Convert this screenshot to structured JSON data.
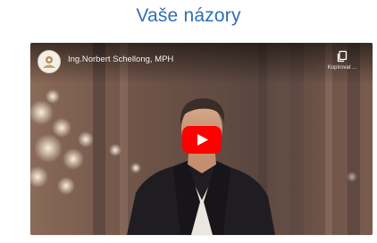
{
  "page": {
    "heading": "Vaše názory"
  },
  "video": {
    "title": "Ing.Norbert Schellong, MPH",
    "copy_link_label": "Kopírovat ...",
    "play_icon": "play-icon",
    "copy_icon": "copy-link-icon",
    "channel_avatar_icon": "channel-avatar"
  },
  "colors": {
    "heading": "#2f6fb5",
    "play_button": "#ff0000",
    "background": "#ffffff"
  }
}
